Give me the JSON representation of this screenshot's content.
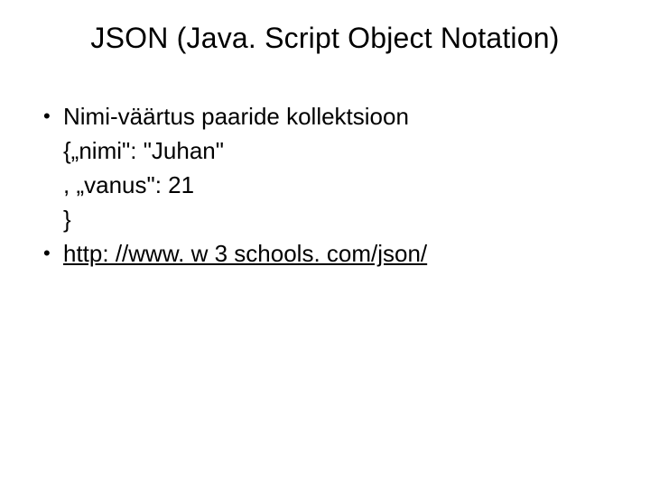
{
  "title": "JSON (Java. Script Object Notation)",
  "bullets": [
    {
      "lead": "Nimi-väärtus paaride kollektsioon",
      "cont": [
        "{„nimi\": \"Juhan\"",
        ", „vanus\": 21",
        "}"
      ]
    },
    {
      "link": "http: //www. w 3 schools. com/json/"
    }
  ],
  "bullet_glyph": "•"
}
